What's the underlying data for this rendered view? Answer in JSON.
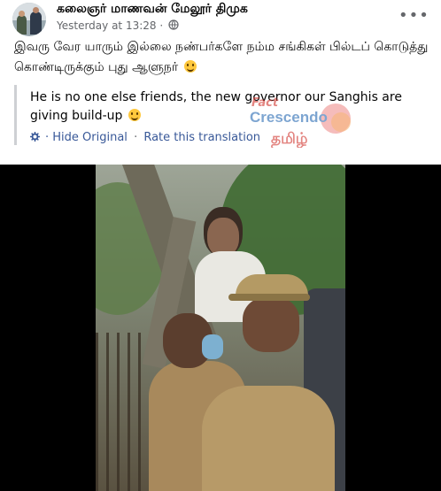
{
  "post": {
    "page_name": "கலைஞர் மாணவன் மேலூர் திமுக",
    "timestamp": "Yesterday at 13:28",
    "separator": "·",
    "privacy_icon": "globe-icon",
    "more_icon": "more-options-icon",
    "more_label": "•••",
    "text": "இவரு வேர யாரும் இல்லை நண்பர்களே நம்ம சங்கிகள் பில்டப் கொடுத்து கொண்டிருக்கும் புது ஆளுநர்",
    "emoji": "grinning-face-emoji"
  },
  "translation": {
    "text": "He is no one else friends, the new governor our Sanghis are giving build-up",
    "settings_icon": "gear-icon",
    "hide_original_label": "Hide Original",
    "separator": "·",
    "rate_label": "Rate this translation"
  },
  "watermark": {
    "line1": "Fact",
    "brand": "Crescendo",
    "lang": "தமிழ்"
  },
  "colors": {
    "link": "#385898",
    "meta": "#65676b",
    "text": "#050505",
    "background": "#ffffff",
    "video_bg": "#000000"
  }
}
